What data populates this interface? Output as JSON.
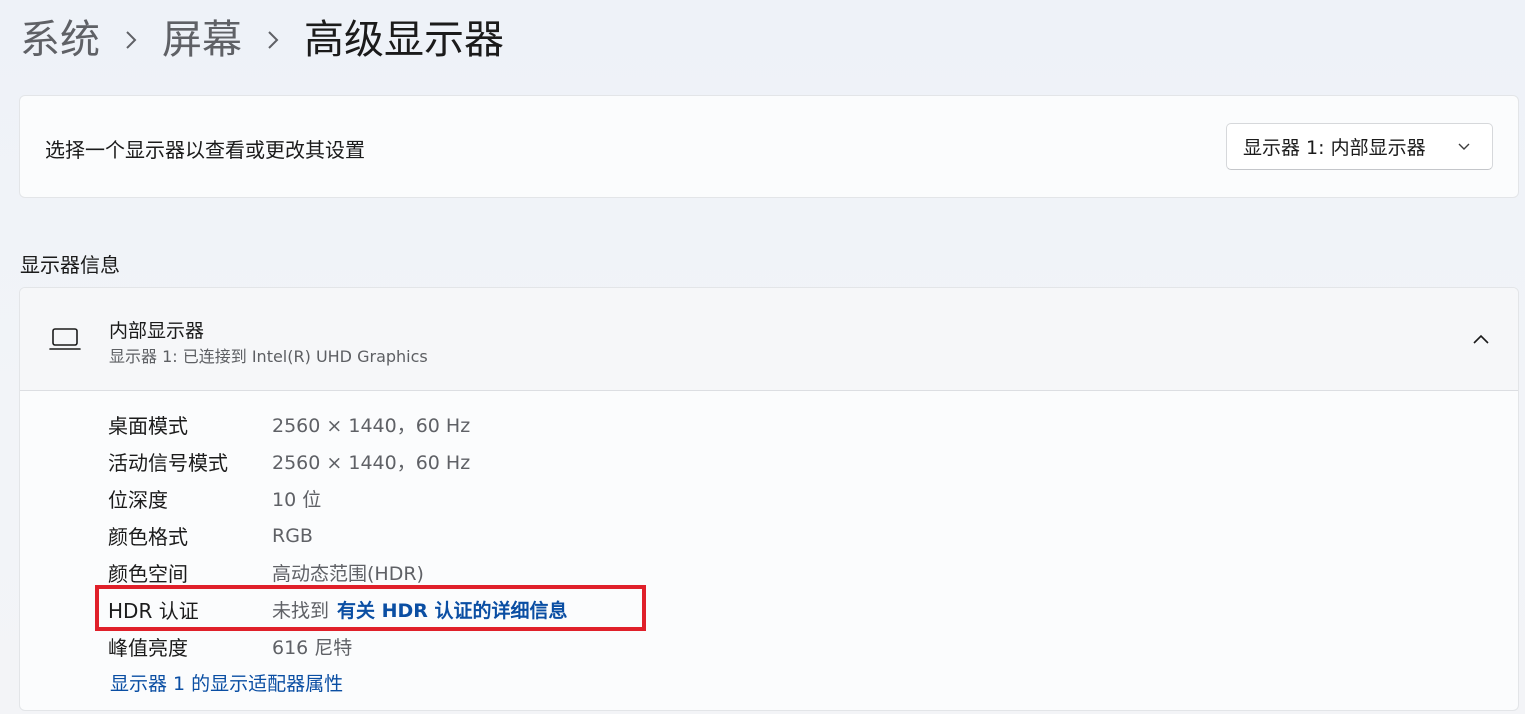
{
  "breadcrumb": {
    "items": [
      "系统",
      "屏幕"
    ],
    "current": "高级显示器"
  },
  "selector": {
    "label": "选择一个显示器以查看或更改其设置",
    "dropdown_value": "显示器 1: 内部显示器"
  },
  "section": {
    "title": "显示器信息"
  },
  "display": {
    "name": "内部显示器",
    "subtitle": "显示器 1: 已连接到 Intel(R) UHD Graphics",
    "rows": [
      {
        "key": "桌面模式",
        "value": "2560 × 1440，60 Hz"
      },
      {
        "key": "活动信号模式",
        "value": "2560 × 1440，60 Hz"
      },
      {
        "key": "位深度",
        "value": "10 位"
      },
      {
        "key": "颜色格式",
        "value": "RGB"
      },
      {
        "key": "颜色空间",
        "value": "高动态范围(HDR)"
      },
      {
        "key": "HDR 认证",
        "value": "未找到",
        "link": "有关 HDR 认证的详细信息"
      },
      {
        "key": "峰值亮度",
        "value": "616 尼特"
      }
    ],
    "adapter_link": "显示器 1 的显示适配器属性"
  },
  "colors": {
    "link": "#0a4ea3",
    "highlight": "#e0202a"
  }
}
